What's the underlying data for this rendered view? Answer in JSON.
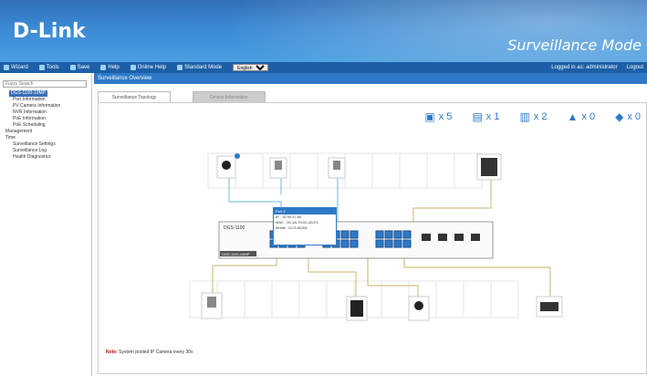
{
  "brand": {
    "logo": "D-Link",
    "mode": "Surveillance Mode"
  },
  "toolbar": {
    "items": [
      "Wizard",
      "Tools",
      "Save",
      "Help",
      "Online Help",
      "Standard Mode"
    ],
    "language": "English",
    "right": [
      "Logged in as: administrator",
      "Logout"
    ]
  },
  "sidebar": {
    "search_placeholder": "Fuzzy Search",
    "selected": "DGS-1100-10MP",
    "items": [
      "Port Information",
      "PV Camera Information",
      "NVR Information",
      "PoE Information",
      "PoE Scheduling"
    ],
    "groups": [
      "Management",
      "Time"
    ],
    "tail": [
      "Surveillance Settings",
      "Surveillance Log",
      "Health Diagnostics"
    ]
  },
  "main": {
    "title": "Surveillance Overview",
    "tabs": [
      "Surveillance Topology",
      "Device Information"
    ],
    "stats": [
      {
        "icon": "ip-camera-icon",
        "count": "x 5"
      },
      {
        "icon": "nvr-icon",
        "count": "x 1"
      },
      {
        "icon": "server-icon",
        "count": "x 2"
      },
      {
        "icon": "ap-icon",
        "count": "x 0"
      },
      {
        "icon": "router-icon",
        "count": "x 0"
      }
    ],
    "switch_label": "DGS-1100",
    "switch_model": "DGS-1100-10MP",
    "tooltip": [
      "Port 2",
      "IP : 10.90.37.60",
      "MAC : 00-1A-79-00-4D-E1",
      "Model : DCS-5020L"
    ],
    "note_label": "Note:",
    "note_text": "System pooled IP Camera every 30s",
    "colors": {
      "accent": "#2e79c7",
      "header": "#2f6fb6"
    }
  }
}
